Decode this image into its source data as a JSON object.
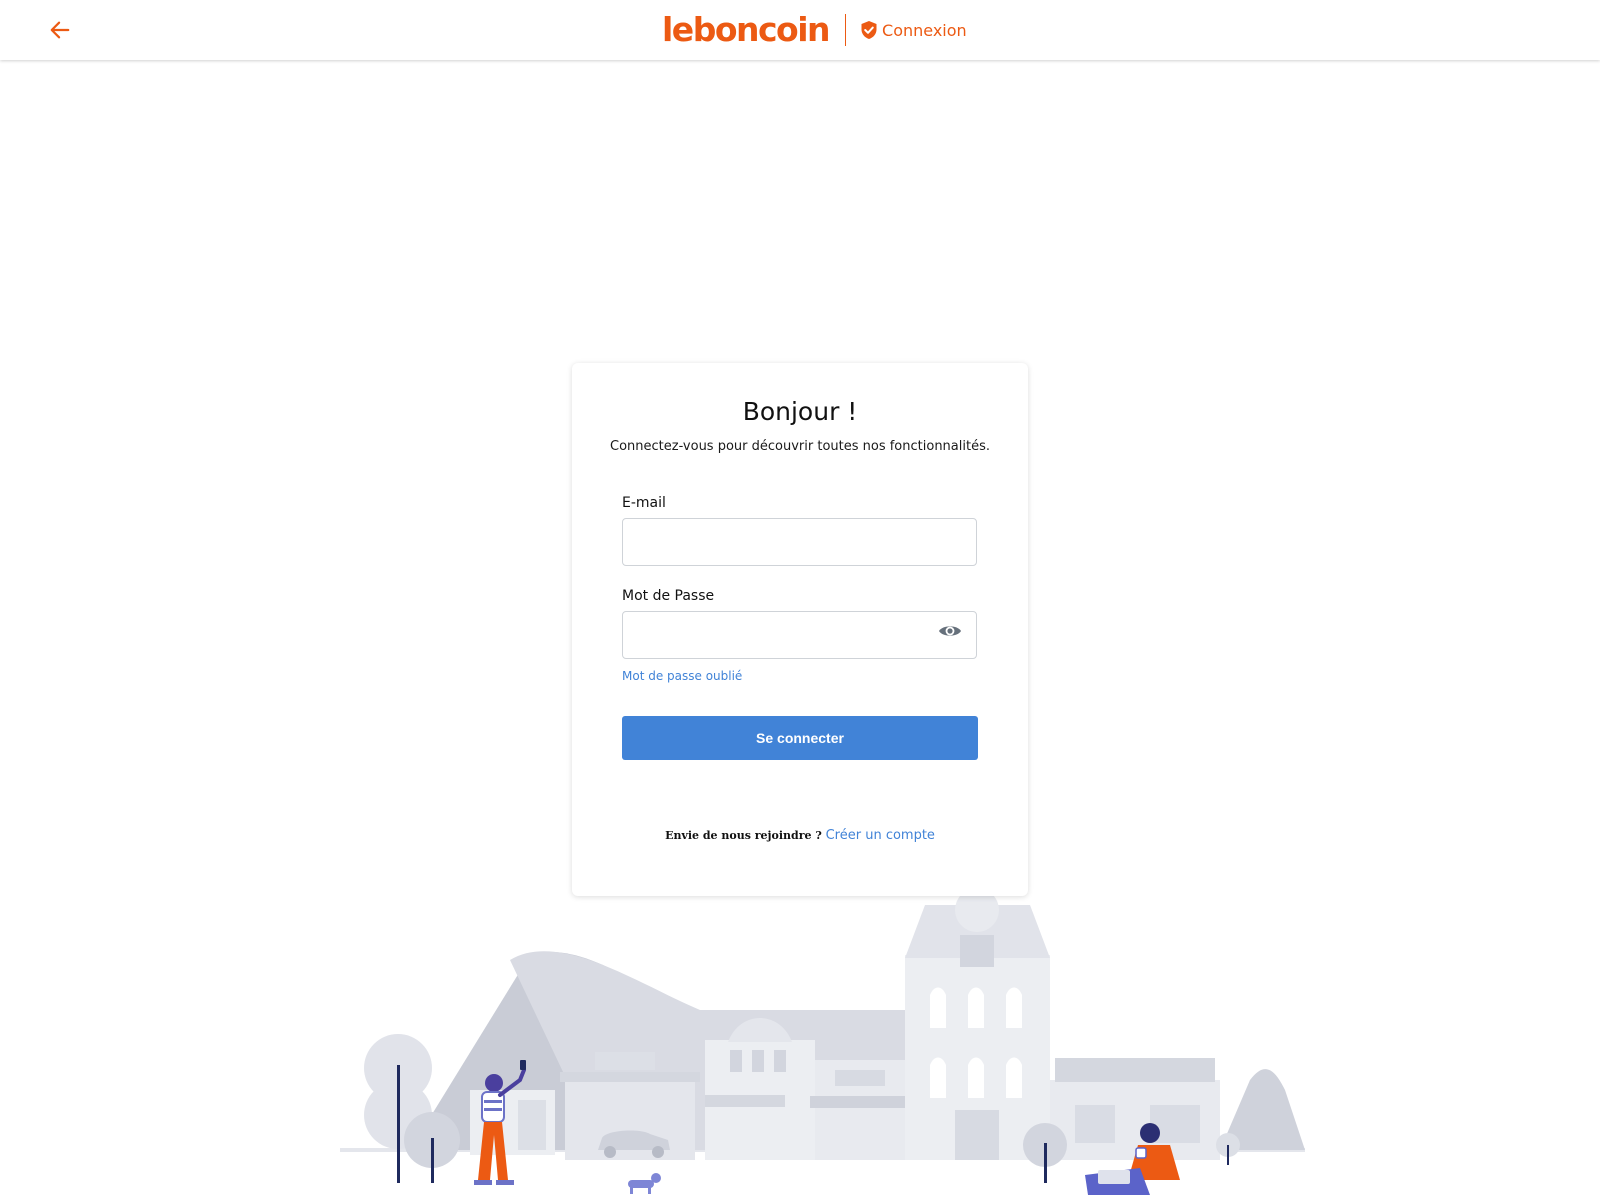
{
  "header": {
    "brand_name": "leboncoin",
    "section_label": "Connexion",
    "colors": {
      "brand": "#ec5a13"
    },
    "icons": {
      "back": "arrow-left-icon",
      "section": "shield-check-icon"
    }
  },
  "login": {
    "title": "Bonjour !",
    "subtitle": "Connectez-vous pour découvrir toutes nos fonctionnalités.",
    "email_label": "E-mail",
    "email_value": "",
    "password_label": "Mot de Passe",
    "password_value": "",
    "password_toggle_icon": "eye-icon",
    "forgot_password": "Mot de passe oublié",
    "submit_label": "Se connecter",
    "signup_prompt": "Envie de nous rejoindre ?",
    "signup_link": "Créer un compte",
    "colors": {
      "primary": "#4183d7"
    }
  }
}
